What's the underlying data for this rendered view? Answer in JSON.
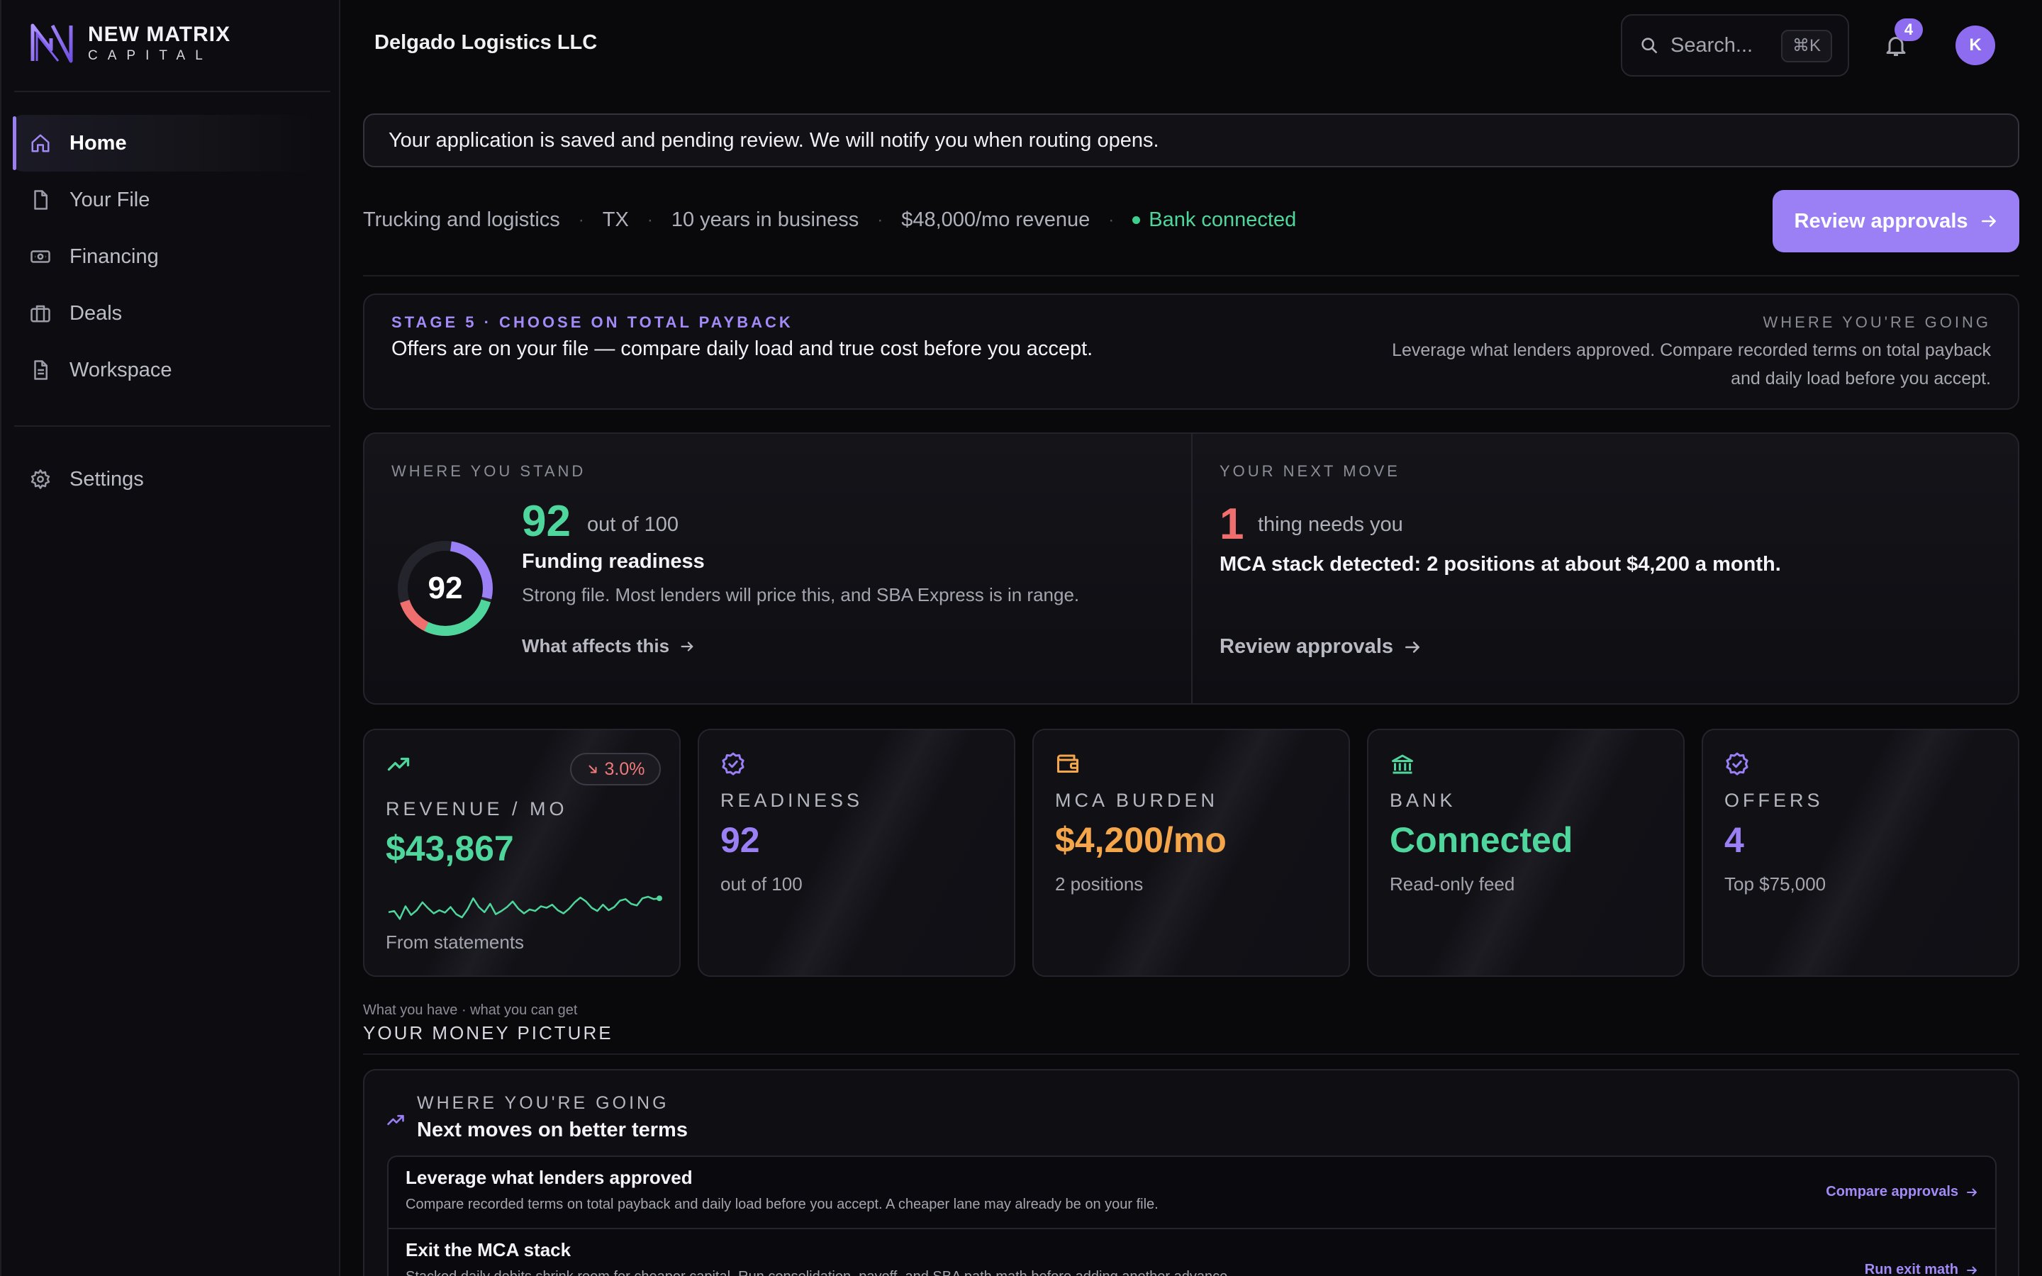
{
  "brand": {
    "line1": "NEW MATRIX",
    "line2": "CAPITAL",
    "accent": "#9a7ff5"
  },
  "sidebar": {
    "items": [
      {
        "label": "Home",
        "icon": "home-icon",
        "active": true
      },
      {
        "label": "Your File",
        "icon": "file-icon"
      },
      {
        "label": "Financing",
        "icon": "cash-icon"
      },
      {
        "label": "Deals",
        "icon": "briefcase-icon"
      },
      {
        "label": "Workspace",
        "icon": "document-icon"
      }
    ],
    "settings_label": "Settings"
  },
  "header": {
    "company": "Delgado Logistics LLC",
    "search_placeholder": "Search...",
    "search_shortcut": "⌘K",
    "notification_count": "4",
    "avatar_initial": "K"
  },
  "banner": {
    "text": "Your application is saved and pending review. We will notify you when routing opens."
  },
  "meta": {
    "industry": "Trucking and logistics",
    "state": "TX",
    "years": "10 years in business",
    "revenue": "$48,000/mo revenue",
    "bank": "Bank connected",
    "review_button": "Review approvals"
  },
  "stage": {
    "kicker": "STAGE 5 · CHOOSE ON TOTAL PAYBACK",
    "title": "Offers are on your file — compare daily load and true cost before you accept.",
    "going_kicker": "WHERE YOU'RE GOING",
    "going_text": "Leverage what lenders approved. Compare recorded terms on total payback and daily load before you accept."
  },
  "stand": {
    "kicker": "WHERE YOU STAND",
    "score": "92",
    "score_fraction": 0.92,
    "out_of": "out of 100",
    "title": "Funding readiness",
    "desc": "Strong file. Most lenders will price this, and SBA Express is in range.",
    "link": "What affects this"
  },
  "next_move": {
    "kicker": "YOUR NEXT MOVE",
    "count": "1",
    "needs": "thing needs you",
    "detail": "MCA stack detected: 2 positions at about $4,200 a month.",
    "link": "Review approvals"
  },
  "metrics": {
    "revenue": {
      "kicker": "REVENUE / MO",
      "value": "$43,867",
      "delta": "3.0%",
      "sub": "From statements",
      "color": "#4fd69c",
      "spark": [
        0.55,
        0.52,
        0.72,
        0.4,
        0.62,
        0.5,
        0.3,
        0.45,
        0.58,
        0.5,
        0.56,
        0.42,
        0.6,
        0.68,
        0.48,
        0.2,
        0.42,
        0.55,
        0.34,
        0.6,
        0.52,
        0.42,
        0.28,
        0.46,
        0.58,
        0.48,
        0.52,
        0.4,
        0.44,
        0.36,
        0.5,
        0.58,
        0.46,
        0.3,
        0.18,
        0.28,
        0.44,
        0.52,
        0.36,
        0.5,
        0.42,
        0.26,
        0.22,
        0.34,
        0.38,
        0.2,
        0.16,
        0.22,
        0.2
      ]
    },
    "readiness": {
      "kicker": "READINESS",
      "value": "92",
      "sub": "out of 100",
      "color": "#9a7ff5"
    },
    "mca": {
      "kicker": "MCA BURDEN",
      "value": "$4,200/mo",
      "sub": "2 positions",
      "color": "#f5a54a"
    },
    "bank": {
      "kicker": "BANK",
      "value": "Connected",
      "sub": "Read-only feed",
      "color": "#4fd69c"
    },
    "offers": {
      "kicker": "OFFERS",
      "value": "4",
      "sub": "Top $75,000",
      "color": "#9a7ff5"
    }
  },
  "money": {
    "eyebrow": "What you have · what you can get",
    "title": "YOUR MONEY PICTURE",
    "kicker": "WHERE YOU'RE GOING",
    "heading": "Next moves on better terms",
    "moves": [
      {
        "title": "Leverage what lenders approved",
        "desc": "Compare recorded terms on total payback and daily load before you accept. A cheaper lane may already be on your file.",
        "link": "Compare approvals"
      },
      {
        "title": "Exit the MCA stack",
        "desc": "Stacked daily debits shrink room for cheaper capital. Run consolidation, payoff, and SBA path math before adding another advance.",
        "link": "Run exit math"
      }
    ]
  }
}
